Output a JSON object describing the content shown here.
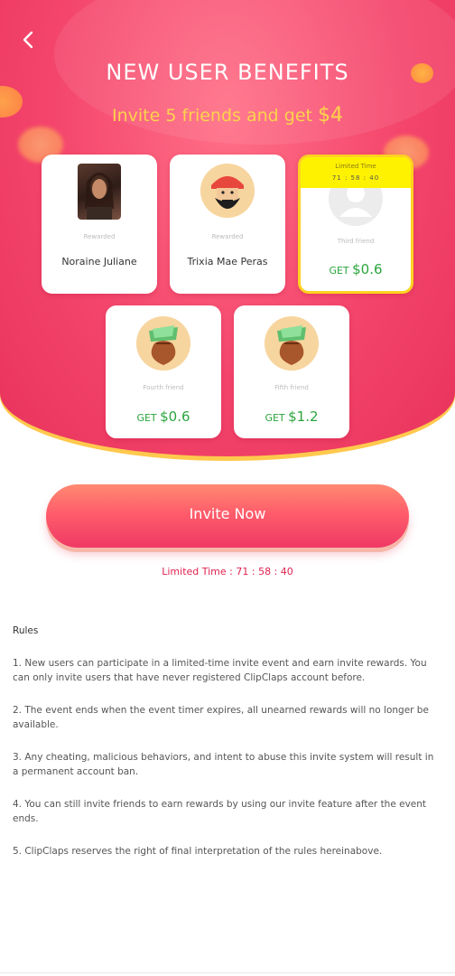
{
  "header": {
    "back_icon": "chevron-left-icon",
    "title": "NEW USER BENEFITS",
    "subtitle_prefix": "Invite 5 friends and get ",
    "subtitle_amount": "$4"
  },
  "cards": [
    {
      "status": "Rewarded",
      "name": "Noraine Juliane"
    },
    {
      "status": "Rewarded",
      "name": "Trixia Mae Peras"
    },
    {
      "banner_label": "Limited Time",
      "banner_timer": "71 : 58 : 40",
      "status": "Third friend",
      "reward_prefix": "GET ",
      "reward_amount": "$0.6"
    },
    {
      "status": "Fourth friend",
      "reward_prefix": "GET ",
      "reward_amount": "$0.6"
    },
    {
      "status": "Fifth friend",
      "reward_prefix": "GET ",
      "reward_amount": "$1.2"
    }
  ],
  "invite_button": "Invite Now",
  "limited_time": "Limited Time : 71 : 58 : 40",
  "rules": {
    "heading": "Rules",
    "items": [
      "1. New users can participate in a limited-time invite event and earn invite rewards. You can only invite users that have never registered ClipClaps account before.",
      "2. The event ends when the event timer expires, all unearned rewards will no longer be available.",
      "3. Any cheating, malicious behaviors, and intent to abuse this invite system will result in a permanent account ban.",
      "4. You can still invite friends to earn rewards by using our invite feature after the event ends.",
      "5. ClipClaps reserves the right of final interpretation of the rules hereinabove."
    ]
  },
  "colors": {
    "hero_pink": "#f4456c",
    "gold": "#ffd34d",
    "reward_green": "#2aa53b",
    "limit_red": "#e0224f"
  }
}
